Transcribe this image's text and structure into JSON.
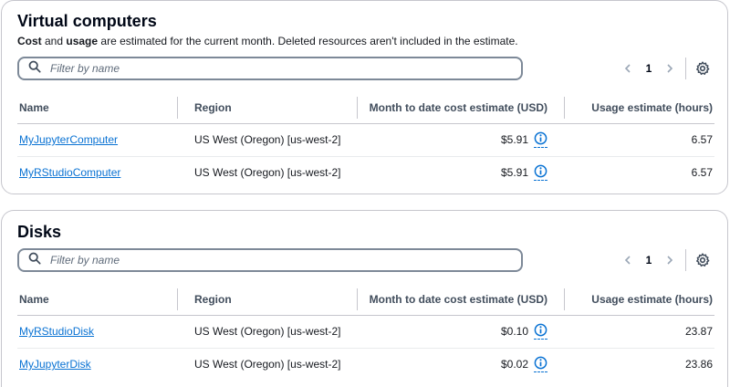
{
  "virtual_computers": {
    "title": "Virtual computers",
    "desc_cost": "Cost",
    "desc_and": " and ",
    "desc_usage": "usage",
    "desc_rest": " are estimated for the current month. Deleted resources aren't included in the estimate.",
    "search_placeholder": "Filter by name",
    "page": "1",
    "columns": [
      "Name",
      "Region",
      "Month to date cost estimate (USD)",
      "Usage estimate (hours)"
    ],
    "rows": [
      {
        "name": "MyJupyterComputer",
        "region": "US West (Oregon) [us-west-2]",
        "cost": "$5.91",
        "usage": "6.57"
      },
      {
        "name": "MyRStudioComputer",
        "region": "US West (Oregon) [us-west-2]",
        "cost": "$5.91",
        "usage": "6.57"
      }
    ]
  },
  "disks": {
    "title": "Disks",
    "search_placeholder": "Filter by name",
    "page": "1",
    "columns": [
      "Name",
      "Region",
      "Month to date cost estimate (USD)",
      "Usage estimate (hours)"
    ],
    "rows": [
      {
        "name": "MyRStudioDisk",
        "region": "US West (Oregon) [us-west-2]",
        "cost": "$0.10",
        "usage": "23.87"
      },
      {
        "name": "MyJupyterDisk",
        "region": "US West (Oregon) [us-west-2]",
        "cost": "$0.02",
        "usage": "23.86"
      }
    ]
  },
  "icons": {
    "search": "search-icon",
    "prev": "chevron-left-icon",
    "next": "chevron-right-icon",
    "settings": "gear-icon",
    "info": "info-icon"
  },
  "colors": {
    "link": "#0972d3",
    "border": "#c6c6cd",
    "heading": "#000716"
  }
}
